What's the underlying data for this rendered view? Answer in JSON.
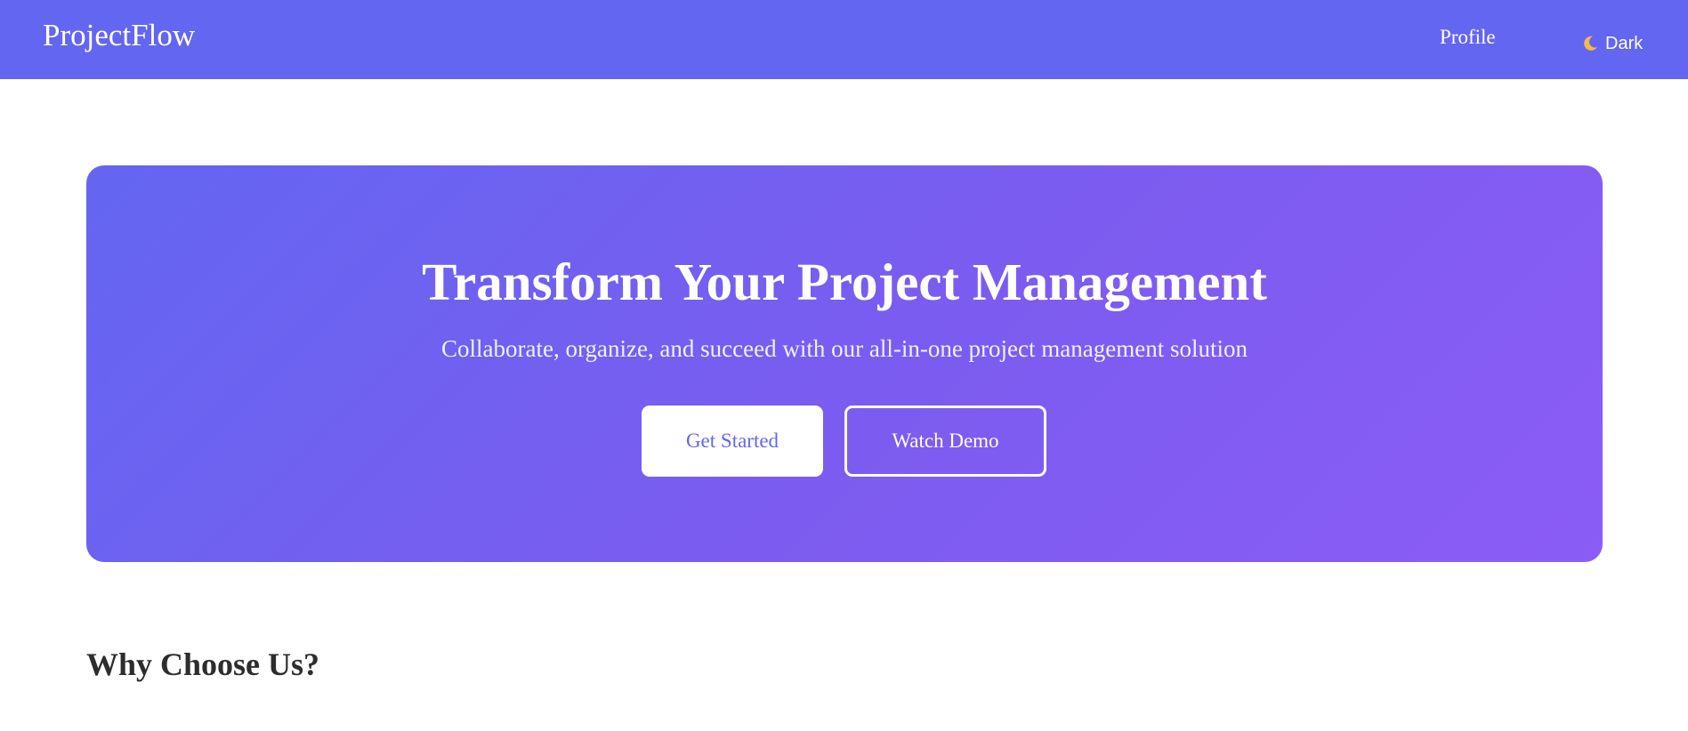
{
  "navbar": {
    "brand": "ProjectFlow",
    "profile_label": "Profile",
    "theme_toggle": {
      "icon": "crescent-moon-icon",
      "label": "Dark"
    }
  },
  "hero": {
    "title": "Transform Your Project Management",
    "subtitle": "Collaborate, organize, and succeed with our all-in-one project management solution",
    "primary_button": "Get Started",
    "secondary_button": "Watch Demo"
  },
  "features": {
    "title": "Why Choose Us?"
  },
  "colors": {
    "navbar_bg": "#6366f1",
    "hero_gradient_start": "#6366f1",
    "hero_gradient_end": "#8b5cf6",
    "primary_button_text": "#6366f1",
    "heading_text": "#2d2d2d"
  }
}
